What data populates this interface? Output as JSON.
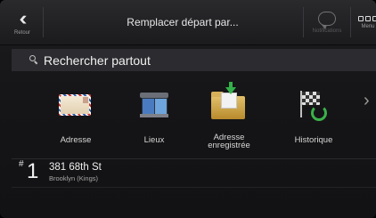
{
  "header": {
    "back_label": "Retour",
    "title": "Remplacer départ par...",
    "notifications_label": "Notifications",
    "menu_label": "Menu"
  },
  "search": {
    "placeholder": "Rechercher partout"
  },
  "categories": [
    {
      "label": "Adresse",
      "icon": "envelope-icon"
    },
    {
      "label": "Lieux",
      "icon": "places-icon"
    },
    {
      "label": "Adresse enregistrée",
      "label_line1": "Adresse",
      "label_line2": "enregistrée",
      "icon": "saved-address-folder-icon"
    },
    {
      "label": "Historique",
      "icon": "history-flag-icon"
    }
  ],
  "recent": [
    {
      "hash": "#",
      "index": "1",
      "title": "381 68th St",
      "subtitle": "Brooklyn (Kings)"
    }
  ],
  "colors": {
    "background": "#151517",
    "search_bg": "#2c2c30",
    "text": "#ffffff",
    "accent_green": "#34b04a"
  }
}
